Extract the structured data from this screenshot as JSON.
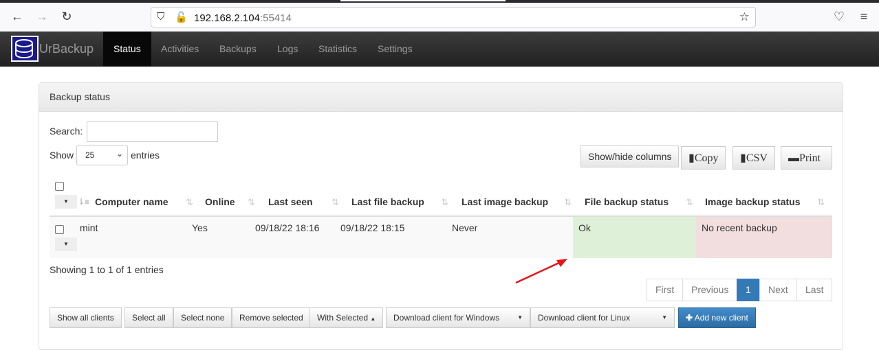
{
  "browser": {
    "host": "192.168.2.104",
    "port": ":55414"
  },
  "navbar": {
    "brand": "UrBackup",
    "items": [
      "Status",
      "Activities",
      "Backups",
      "Logs",
      "Statistics",
      "Settings"
    ]
  },
  "panel": {
    "title": "Backup status"
  },
  "search": {
    "label": "Search:",
    "value": ""
  },
  "length": {
    "show": "Show",
    "value": "25",
    "entries": "entries"
  },
  "tools": {
    "showhide": "Show/hide columns",
    "copy": "Copy",
    "csv": "CSV",
    "print": "Print"
  },
  "table": {
    "headers": [
      "Computer name",
      "Online",
      "Last seen",
      "Last file backup",
      "Last image backup",
      "File backup status",
      "Image backup status"
    ],
    "rows": [
      {
        "name": "mint",
        "online": "Yes",
        "last_seen": "09/18/22 18:16",
        "last_file": "09/18/22 18:15",
        "last_image": "Never",
        "file_status": "Ok",
        "image_status": "No recent backup"
      }
    ]
  },
  "info": "Showing 1 to 1 of 1 entries",
  "pagination": {
    "first": "First",
    "previous": "Previous",
    "current": "1",
    "next": "Next",
    "last": "Last"
  },
  "actions": {
    "show_all": "Show all clients",
    "select_all": "Select all",
    "select_none": "Select none",
    "remove": "Remove selected",
    "with_selected": "With Selected",
    "dl_windows": "Download client for Windows",
    "dl_linux": "Download client for Linux",
    "add": "Add new client"
  },
  "colors": {
    "ok": "#dff0d8",
    "bad": "#f2dede",
    "primary": "#337ab7",
    "arrow": "#e8141a"
  }
}
